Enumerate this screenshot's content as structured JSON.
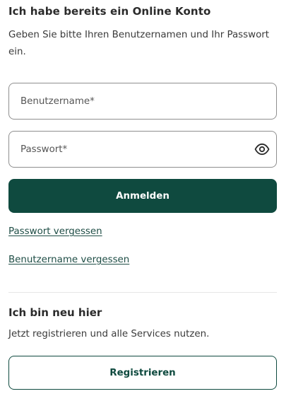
{
  "login": {
    "heading": "Ich habe bereits ein Online Konto",
    "intro": "Geben Sie bitte Ihren Benutzernamen und Ihr Passwort ein.",
    "username_placeholder": "Benutzername*",
    "username_value": "",
    "password_placeholder": "Passwort*",
    "password_value": "",
    "password_toggle_icon": "eye-icon",
    "submit_label": "Anmelden",
    "forgot_password_link": "Passwort vergessen",
    "forgot_username_link": "Benutzername vergessen"
  },
  "register": {
    "heading": "Ich bin neu hier",
    "text": "Jetzt registrieren und alle Services nutzen.",
    "button_label": "Registrieren"
  },
  "colors": {
    "brand": "#0f4a3f",
    "text": "#2b2b2b",
    "border": "#8f8f8f",
    "divider": "#e6e6e6"
  }
}
